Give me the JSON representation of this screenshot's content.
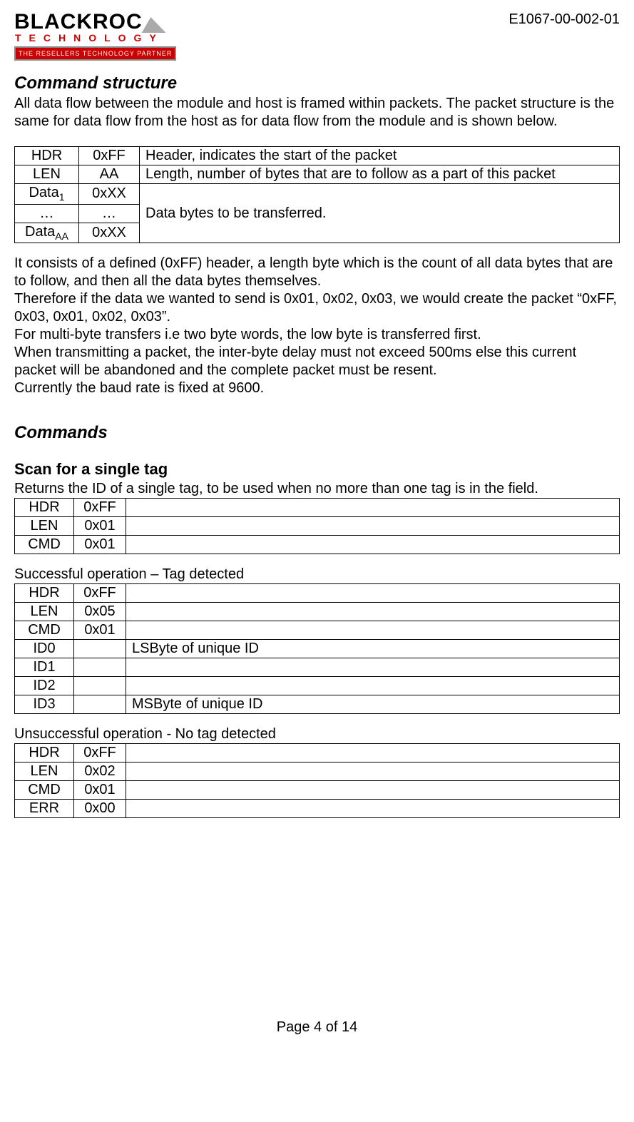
{
  "header": {
    "doc_id": "E1067-00-002-01",
    "logo_main": "BLACKROC",
    "logo_sub": "TECHNOLOGY",
    "logo_tagline": "THE RESELLERS TECHNOLOGY PARTNER"
  },
  "section1": {
    "title": "Command structure",
    "intro": "All data flow between the module and host is framed within packets. The packet structure is the same for data flow from the host as for data flow from the module and is shown below."
  },
  "table1": {
    "rows": [
      {
        "name": "HDR",
        "val": "0xFF",
        "desc": "Header, indicates the start of the packet"
      },
      {
        "name": "LEN",
        "val": "AA",
        "desc": "Length, number of bytes that are to follow as a part of this packet"
      }
    ],
    "data_name_1": "Data",
    "data_sub_1": "1",
    "data_val_1": "0xXX",
    "dots": "…",
    "data_name_aa": "Data",
    "data_sub_aa": "AA",
    "data_val_aa": "0xXX",
    "data_desc": "Data bytes to be transferred."
  },
  "explain": {
    "p1": "It consists of a defined (0xFF) header, a length byte which is the count of all data bytes that are to follow, and then all the data bytes themselves.",
    "p2": "Therefore if the data we wanted to send is 0x01, 0x02, 0x03, we would create the packet “0xFF, 0x03, 0x01, 0x02, 0x03”.",
    "p3": "For multi-byte transfers i.e two byte words, the low byte is transferred first.",
    "p4": "When transmitting a packet, the inter-byte delay must not exceed 500ms else this current packet will be abandoned and the complete packet must be resent.",
    "p5": "Currently the baud rate is fixed at 9600."
  },
  "section2": {
    "title": "Commands",
    "sub1": "Scan for a single tag",
    "sub1_intro": "Returns the ID of a single tag, to be used when no more than one tag is in the field."
  },
  "table_cmd": {
    "rows": [
      {
        "name": "HDR",
        "val": "0xFF",
        "desc": ""
      },
      {
        "name": "LEN",
        "val": "0x01",
        "desc": ""
      },
      {
        "name": "CMD",
        "val": "0x01",
        "desc": ""
      }
    ]
  },
  "success": {
    "label": "Successful operation – Tag detected",
    "rows": [
      {
        "name": "HDR",
        "val": "0xFF",
        "desc": ""
      },
      {
        "name": "LEN",
        "val": "0x05",
        "desc": ""
      },
      {
        "name": "CMD",
        "val": "0x01",
        "desc": ""
      },
      {
        "name": "ID0",
        "val": "",
        "desc": "LSByte of unique ID"
      },
      {
        "name": "ID1",
        "val": "",
        "desc": ""
      },
      {
        "name": "ID2",
        "val": "",
        "desc": ""
      },
      {
        "name": "ID3",
        "val": "",
        "desc": "MSByte of unique ID"
      }
    ]
  },
  "fail": {
    "label": "Unsuccessful operation -  No tag detected",
    "rows": [
      {
        "name": "HDR",
        "val": "0xFF",
        "desc": ""
      },
      {
        "name": "LEN",
        "val": "0x02",
        "desc": ""
      },
      {
        "name": "CMD",
        "val": "0x01",
        "desc": ""
      },
      {
        "name": "ERR",
        "val": "0x00",
        "desc": ""
      }
    ]
  },
  "footer": {
    "page": "Page 4 of 14"
  }
}
